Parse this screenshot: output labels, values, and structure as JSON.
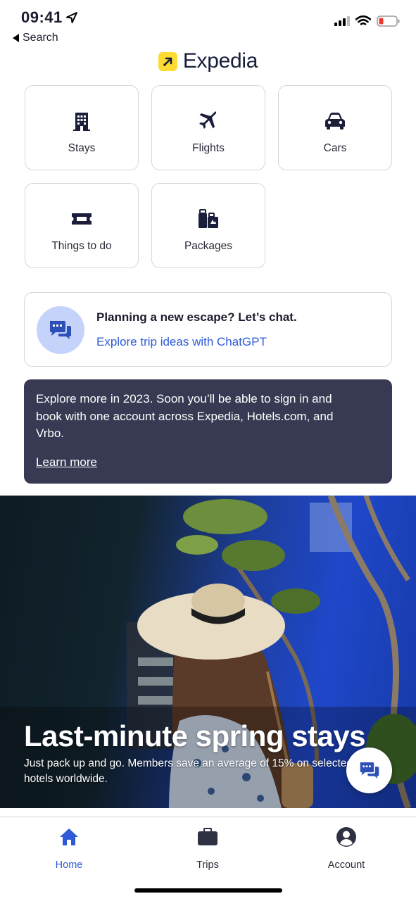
{
  "status_bar": {
    "time": "09:41",
    "back_label": "Search"
  },
  "brand": {
    "name": "Expedia",
    "accent": "#fddb32",
    "text_color": "#191e3b"
  },
  "categories": [
    {
      "label": "Stays",
      "icon": "building-icon"
    },
    {
      "label": "Flights",
      "icon": "airplane-icon"
    },
    {
      "label": "Cars",
      "icon": "car-icon"
    },
    {
      "label": "Things to do",
      "icon": "ticket-icon"
    },
    {
      "label": "Packages",
      "icon": "luggage-icon"
    }
  ],
  "chat_card": {
    "title": "Planning a new escape? Let’s chat.",
    "link": "Explore trip ideas with ChatGPT",
    "icon": "chat-bubbles-icon"
  },
  "info_banner": {
    "text": "Explore more in 2023. Soon you’ll be able to sign in and book with one account across Expedia, Hotels.com, and Vrbo.",
    "link": "Learn more",
    "background": "#373a52"
  },
  "hero": {
    "title": "Last-minute spring stays",
    "subtitle": "Just pack up and go. Members save an average of 15% on selected hotels worldwide."
  },
  "tab_bar": {
    "tabs": [
      {
        "label": "Home",
        "icon": "home-icon",
        "active": true
      },
      {
        "label": "Trips",
        "icon": "briefcase-icon",
        "active": false
      },
      {
        "label": "Account",
        "icon": "account-icon",
        "active": false
      }
    ],
    "active_color": "#2e5ad7"
  }
}
